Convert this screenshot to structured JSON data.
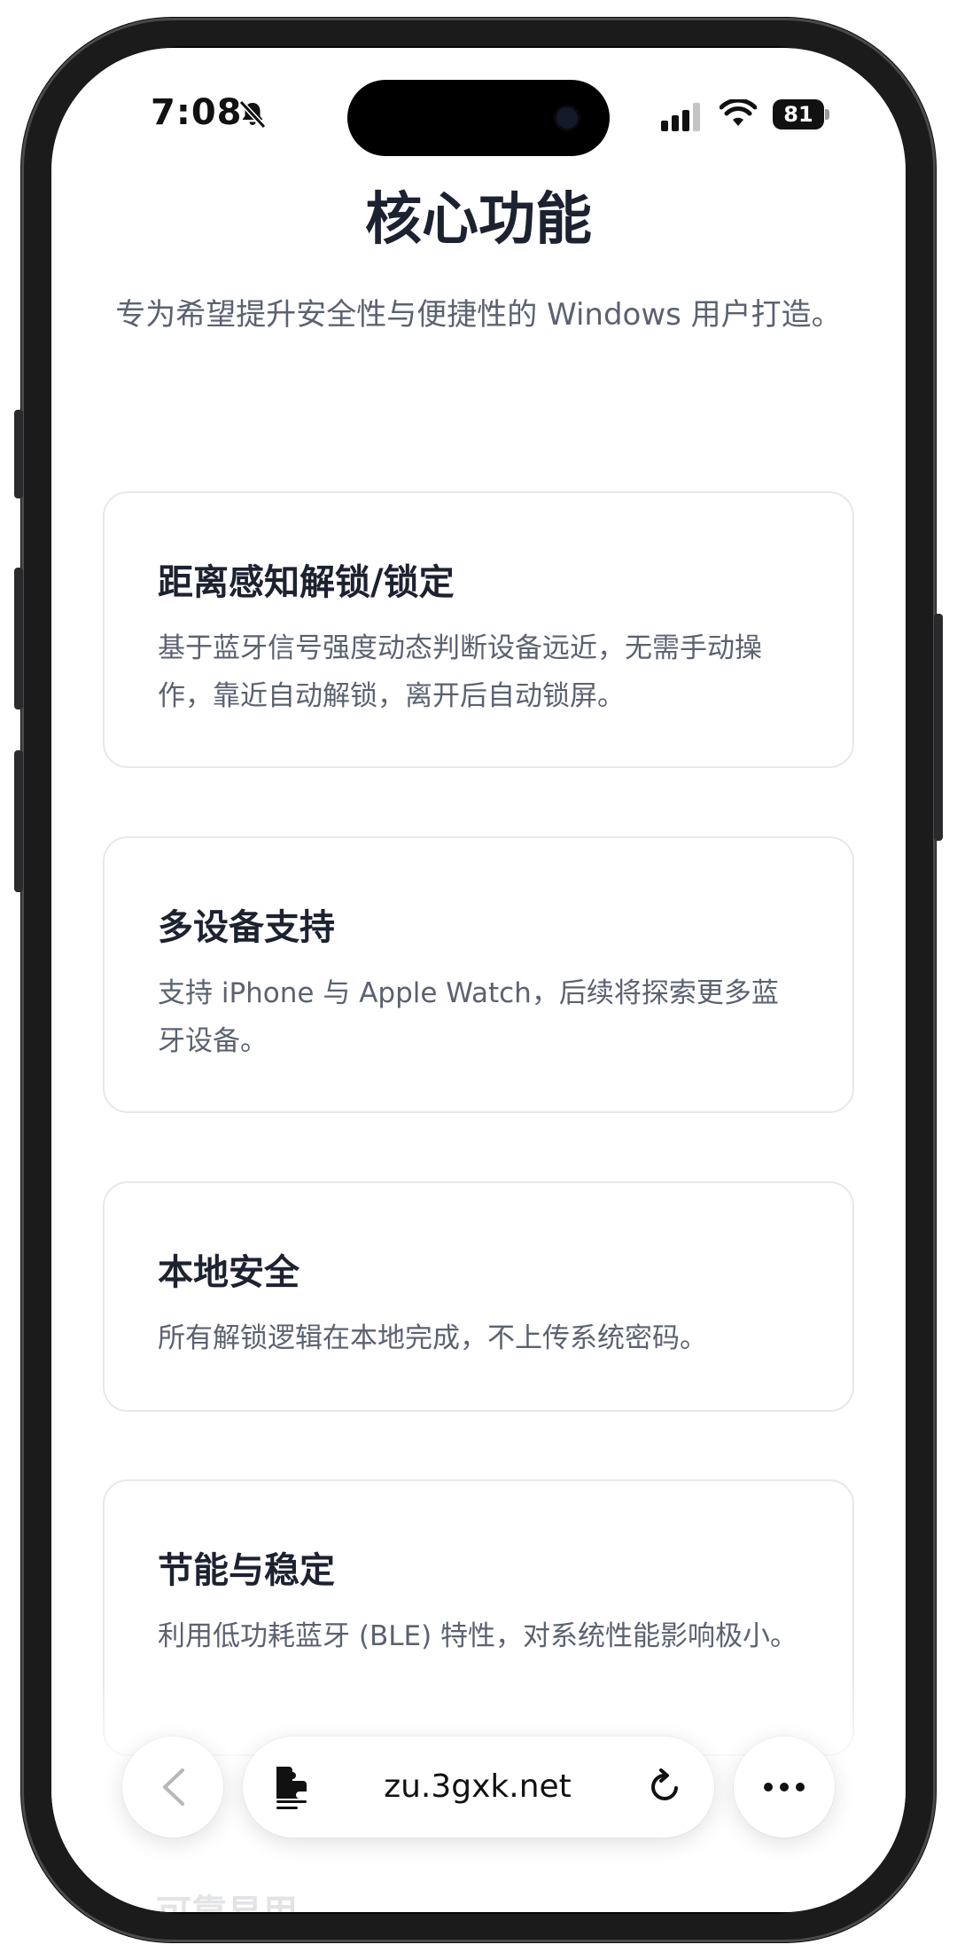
{
  "status_bar": {
    "time": "7:08",
    "battery": "81"
  },
  "page": {
    "title": "核心功能",
    "subtitle": "专为希望提升安全性与便捷性的 Windows 用户打造。"
  },
  "features": [
    {
      "title": "距离感知解锁/锁定",
      "description": "基于蓝牙信号强度动态判断设备远近，无需手动操作，靠近自动解锁，离开后自动锁屏。"
    },
    {
      "title": "多设备支持",
      "description": "支持 iPhone 与 Apple Watch，后续将探索更多蓝牙设备。"
    },
    {
      "title": "本地安全",
      "description": "所有解锁逻辑在本地完成，不上传系统密码。"
    },
    {
      "title": "节能与稳定",
      "description": "利用低功耗蓝牙 (BLE) 特性，对系统性能影响极小。"
    }
  ],
  "next_section_peek": "可靠易用",
  "toolbar": {
    "url": "zu.3gxk.net"
  },
  "icons": {
    "status": [
      "bell-slash-icon",
      "signal-icon",
      "wifi-icon",
      "battery-icon"
    ],
    "toolbar": [
      "chevron-left-icon",
      "reader-icon",
      "reload-icon",
      "more-dots-icon"
    ]
  },
  "colors": {
    "title": "#1c2230",
    "body_text": "#5b6270",
    "card_border": "#e6e8ec",
    "frame": "#1b1b1c"
  }
}
